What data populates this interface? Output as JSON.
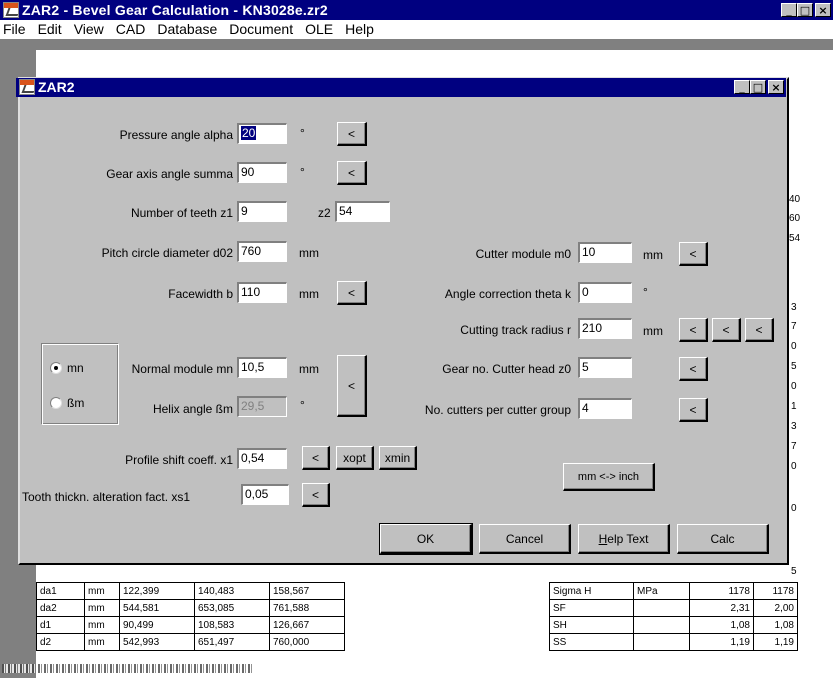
{
  "window": {
    "title": "ZAR2 - Bevel Gear Calculation  -  KN3028e.zr2",
    "btn_min": "_",
    "btn_max": "□",
    "btn_close": "×"
  },
  "menu": [
    "File",
    "Edit",
    "View",
    "CAD",
    "Database",
    "Document",
    "OLE",
    "Help"
  ],
  "dialog": {
    "title": "ZAR2",
    "pressure_angle": {
      "label": "Pressure angle alpha",
      "value": "20",
      "unit": "°"
    },
    "gear_axis_angle": {
      "label": "Gear axis angle summa",
      "value": "90",
      "unit": "°"
    },
    "teeth": {
      "label_z1": "Number of teeth z1",
      "value_z1": "9",
      "label_z2": "z2",
      "value_z2": "54"
    },
    "pitch_diameter": {
      "label": "Pitch circle diameter d02",
      "value": "760",
      "unit": "mm"
    },
    "facewidth": {
      "label": "Facewidth b",
      "value": "110",
      "unit": "mm"
    },
    "mode": {
      "mn": "mn",
      "bm": "ßm",
      "selected": "mn"
    },
    "normal_module": {
      "label": "Normal module mn",
      "value": "10,5",
      "unit": "mm"
    },
    "helix_angle": {
      "label": "Helix angle ßm",
      "value": "29,5",
      "unit": "°"
    },
    "profile_shift": {
      "label": "Profile shift coeff. x1",
      "value": "0,54"
    },
    "tooth_thickness": {
      "label": "Tooth thickn. alteration fact. xs1",
      "value": "0,05"
    },
    "cutter_module": {
      "label": "Cutter module m0",
      "value": "10",
      "unit": "mm"
    },
    "angle_correction": {
      "label": "Angle correction theta k",
      "value": "0",
      "unit": "°"
    },
    "cutting_track": {
      "label": "Cutting track radius r",
      "value": "210",
      "unit": "mm"
    },
    "gear_no_cutter": {
      "label": "Gear no. Cutter head z0",
      "value": "5"
    },
    "cutters_per_group": {
      "label": "No. cutters per cutter group",
      "value": "4"
    },
    "buttons": {
      "arrow": "<",
      "xopt": "xopt",
      "xmin": "xmin",
      "mm_inch": "mm <-> inch",
      "ok": "OK",
      "cancel": "Cancel",
      "help_h": "H",
      "help_rest": "elp Text",
      "calc": "Calc"
    }
  },
  "doc_table_left": {
    "rows": [
      [
        "da1",
        "mm",
        "122,399",
        "140,483",
        "158,567"
      ],
      [
        "da2",
        "mm",
        "544,581",
        "653,085",
        "761,588"
      ],
      [
        "d1",
        "mm",
        "90,499",
        "108,583",
        "126,667"
      ],
      [
        "d2",
        "mm",
        "542,993",
        "651,497",
        "760,000"
      ]
    ]
  },
  "doc_table_right": {
    "rows": [
      [
        "Sigma H",
        "MPa",
        "1178",
        "1178"
      ],
      [
        "SF",
        "",
        "2,31",
        "2,00"
      ],
      [
        "SH",
        "",
        "1,08",
        "1,08"
      ],
      [
        "SS",
        "",
        "1,19",
        "1,19"
      ]
    ]
  },
  "doc_edge_numbers": [
    "40",
    "60",
    "54",
    "3",
    "7",
    "0",
    "5",
    "0",
    "1",
    "3",
    "7",
    "0",
    "0",
    "5"
  ]
}
